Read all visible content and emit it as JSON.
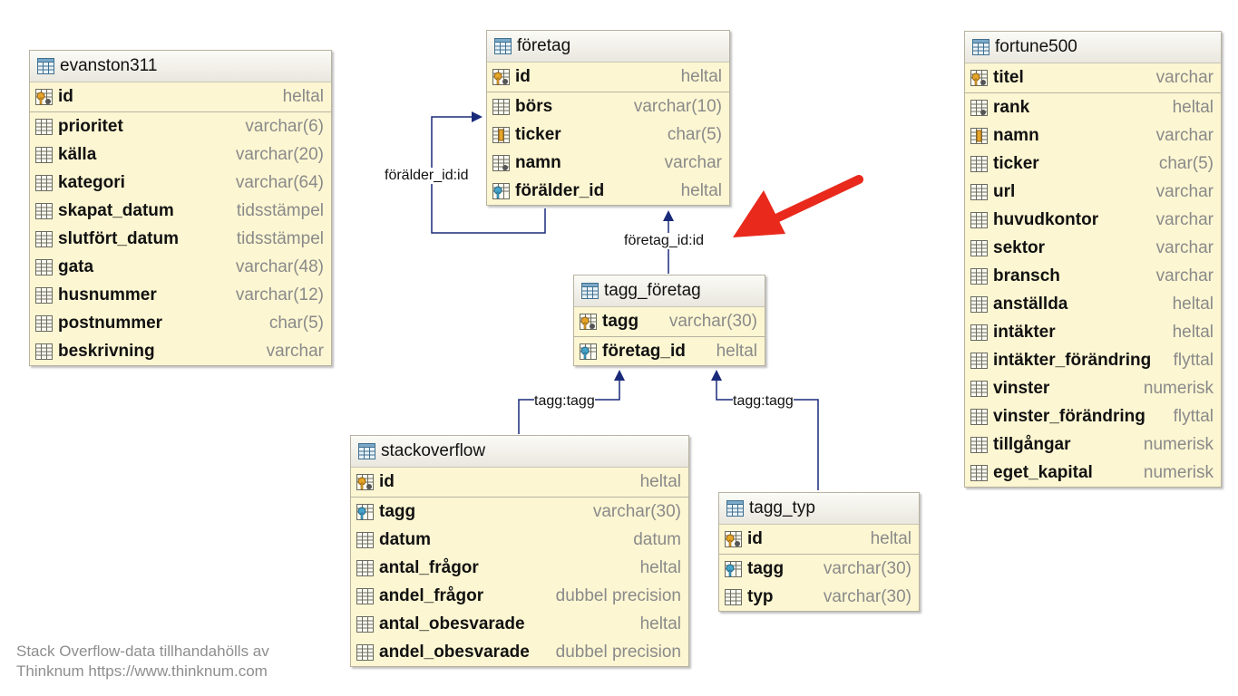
{
  "tables": {
    "evanston311": {
      "title": "evanston311",
      "pk": {
        "name": "id",
        "type": "heltal"
      },
      "columns": [
        {
          "name": "prioritet",
          "type": "varchar(6)"
        },
        {
          "name": "källa",
          "type": "varchar(20)"
        },
        {
          "name": "kategori",
          "type": "varchar(64)"
        },
        {
          "name": "skapat_datum",
          "type": "tidsstämpel"
        },
        {
          "name": "slutfört_datum",
          "type": "tidsstämpel"
        },
        {
          "name": "gata",
          "type": "varchar(48)"
        },
        {
          "name": "husnummer",
          "type": "varchar(12)"
        },
        {
          "name": "postnummer",
          "type": "char(5)"
        },
        {
          "name": "beskrivning",
          "type": "varchar"
        }
      ]
    },
    "foretag": {
      "title": "företag",
      "pk": {
        "name": "id",
        "type": "heltal"
      },
      "columns": [
        {
          "name": "börs",
          "type": "varchar(10)"
        },
        {
          "name": "ticker",
          "type": "char(5)"
        },
        {
          "name": "namn",
          "type": "varchar"
        },
        {
          "name": "förälder_id",
          "type": "heltal"
        }
      ]
    },
    "fortune500": {
      "title": "fortune500",
      "pk": {
        "name": "titel",
        "type": "varchar"
      },
      "columns": [
        {
          "name": "rank",
          "type": "heltal"
        },
        {
          "name": "namn",
          "type": "varchar"
        },
        {
          "name": "ticker",
          "type": "char(5)"
        },
        {
          "name": "url",
          "type": "varchar"
        },
        {
          "name": "huvudkontor",
          "type": "varchar"
        },
        {
          "name": "sektor",
          "type": "varchar"
        },
        {
          "name": "bransch",
          "type": "varchar"
        },
        {
          "name": "anställda",
          "type": "heltal"
        },
        {
          "name": "intäkter",
          "type": "heltal"
        },
        {
          "name": "intäkter_förändring",
          "type": "flyttal"
        },
        {
          "name": "vinster",
          "type": "numerisk"
        },
        {
          "name": "vinster_förändring",
          "type": "flyttal"
        },
        {
          "name": "tillgångar",
          "type": "numerisk"
        },
        {
          "name": "eget_kapital",
          "type": "numerisk"
        }
      ]
    },
    "tagg_foretag": {
      "title": "tagg_företag",
      "pk": {
        "name": "tagg",
        "type": "varchar(30)"
      },
      "columns": [
        {
          "name": "företag_id",
          "type": "heltal"
        }
      ]
    },
    "stackoverflow": {
      "title": "stackoverflow",
      "pk": {
        "name": "id",
        "type": "heltal"
      },
      "columns": [
        {
          "name": "tagg",
          "type": "varchar(30)"
        },
        {
          "name": "datum",
          "type": "datum"
        },
        {
          "name": "antal_frågor",
          "type": "heltal"
        },
        {
          "name": "andel_frågor",
          "type": "dubbel precision"
        },
        {
          "name": "antal_obesvarade",
          "type": "heltal"
        },
        {
          "name": "andel_obesvarade",
          "type": "dubbel precision"
        }
      ]
    },
    "tagg_typ": {
      "title": "tagg_typ",
      "pk": {
        "name": "id",
        "type": "heltal"
      },
      "columns": [
        {
          "name": "tagg",
          "type": "varchar(30)"
        },
        {
          "name": "typ",
          "type": "varchar(30)"
        }
      ]
    }
  },
  "relations": {
    "self_ref": "förälder_id:id",
    "foretag_ref": "företag_id:id",
    "tagg_left": "tagg:tagg",
    "tagg_right": "tagg:tagg"
  },
  "footer": {
    "line1": "Stack Overflow-data tillhandahölls av",
    "line2": "Thinknum https://www.thinknum.com"
  },
  "colors": {
    "relation_line": "#1a2a7a",
    "arrow": "#e8291c",
    "table_bg": "#fcf6d2"
  }
}
